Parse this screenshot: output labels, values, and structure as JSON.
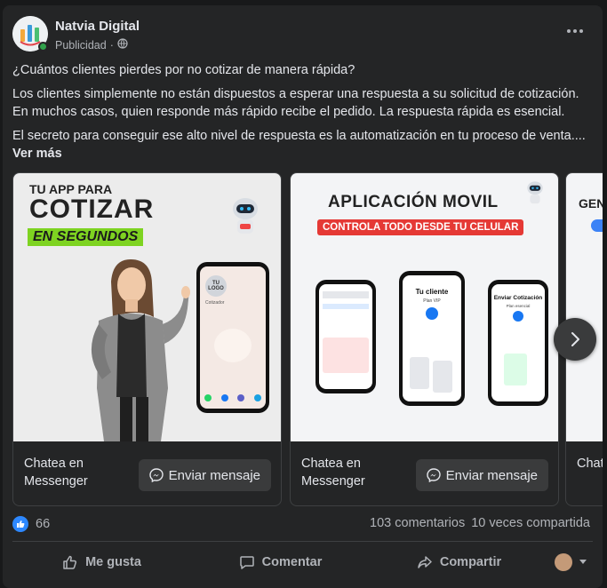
{
  "post": {
    "page_name": "Natvia Digital",
    "meta_label": "Publicidad",
    "meta_separator": "·",
    "paragraphs": [
      "¿Cuántos clientes pierdes por no cotizar de manera rápida?",
      "Los clientes simplemente no están dispuestos a esperar una respuesta a su solicitud de cotización. En muchos casos, quien responde más rápido recibe el pedido. La respuesta rápida es esencial.",
      "El secreto para conseguir ese alto nivel de respuesta es la automatización en tu proceso de venta...."
    ],
    "see_more": " Ver más"
  },
  "carousel": {
    "cards": [
      {
        "headline_1": "TU APP PARA",
        "headline_2": "COTIZAR",
        "headline_3": "EN SEGUNDOS",
        "logo_text": "TU LOGO",
        "screen_label": "Cotizador",
        "cta_label": "Chatea en Messenger",
        "button_label": "Enviar mensaje"
      },
      {
        "headline_1": "APLICACIÓN MOVIL",
        "headline_2": "CONTROLA TODO DESDE TU CELULAR",
        "phone_title_2": "Tu cliente",
        "phone_sub_2": "Plan VIP",
        "phone_title_3": "Enviar Cotización",
        "phone_sub_3": "Plan esencial",
        "cta_label": "Chatea en Messenger",
        "button_label": "Enviar mensaje"
      },
      {
        "headline_1": "GEN",
        "cta_label": "Chat Mess"
      }
    ]
  },
  "stats": {
    "like_count": "66",
    "comments": "103 comentarios",
    "shares": "10 veces compartida"
  },
  "actions": {
    "like": "Me gusta",
    "comment": "Comentar",
    "share": "Compartir"
  },
  "colors": {
    "background": "#18191a",
    "card": "#242526",
    "accent_blue": "#2d88ff",
    "promo_green": "#7ed321",
    "promo_red": "#e53935"
  }
}
